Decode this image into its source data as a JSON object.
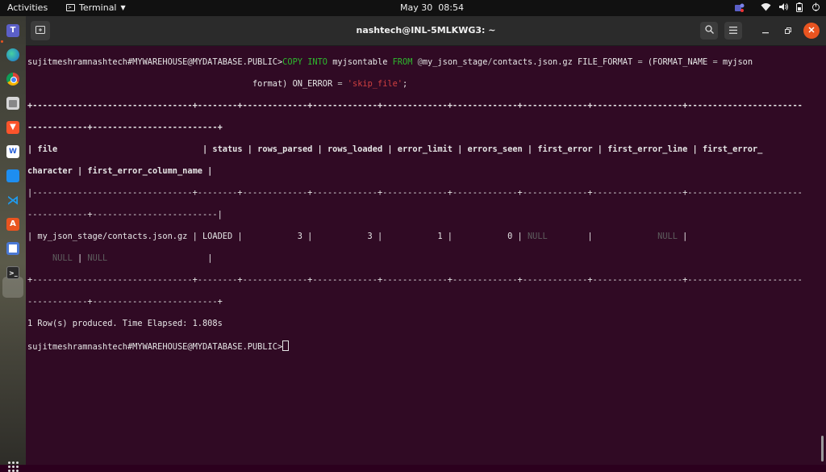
{
  "topbar": {
    "activities": "Activities",
    "app_name": "Terminal",
    "date": "May 30",
    "time": "08:54"
  },
  "dock": {
    "icons": [
      "teams-icon",
      "edge-icon",
      "chrome-icon",
      "files-icon",
      "brave-icon",
      "docs-icon",
      "remote-desktop-icon",
      "vscode-icon",
      "software-center-icon",
      "text-editor-icon",
      "terminal-icon",
      "show-apps-icon"
    ]
  },
  "window": {
    "title": "nashtech@INL-5MLKWG3: ~"
  },
  "terminal": {
    "prompt": "sujitmeshramnashtech#MYWAREHOUSE@MYDATABASE.PUBLIC>",
    "cmd_copy": "COPY",
    "cmd_into": "INTO",
    "cmd_table": "myjsontable",
    "cmd_from": "FROM",
    "cmd_at": "@",
    "cmd_stage": "my_json_stage",
    "cmd_slash": "/",
    "cmd_file": "contacts.json.gz",
    "cmd_file_format": "FILE_FORMAT",
    "cmd_eq1": "=",
    "cmd_format_name": "(FORMAT_NAME",
    "cmd_eq2": "=",
    "cmd_myjson": "myjson",
    "cmd_line2_format": "format)",
    "cmd_on_error": "ON_ERROR",
    "cmd_eq3": "=",
    "cmd_skip_file": "'skip_file'",
    "cmd_semicolon": ";",
    "border_top_1": "+--------------------------------+--------+-------------+-------------+-------------+-------------+-------------+------------------+-----------------------",
    "border_top_2": "------------+-------------------------+",
    "header_1": "| file                             | status | rows_parsed | rows_loaded | error_limit | errors_seen | first_error | first_error_line | first_error_",
    "header_2": "character | first_error_column_name |",
    "border_mid_1": "|--------------------------------+--------+-------------+-------------+-------------+-------------+-------------+------------------+-----------------------",
    "border_mid_2": "------------+-------------------------|",
    "row_pre": "| my_json_stage/contacts.json.gz | LOADED |           3 |           3 |           1 |           0 | ",
    "row_null1": "NULL",
    "row_mid": "        |             ",
    "row_null2": "NULL",
    "row_post": " |",
    "row2_pad": "     ",
    "row2_null3": "NULL",
    "row2_sep": " | ",
    "row2_null4": "NULL",
    "row2_end": "                    |",
    "border_bot_1": "+--------------------------------+--------+-------------+-------------+-------------+-------------+-------------+------------------+-----------------------",
    "border_bot_2": "------------+-------------------------+",
    "result": "1 Row(s) produced. Time Elapsed: 1.808s",
    "prompt2": "sujitmeshramnashtech#MYWAREHOUSE@MYDATABASE.PUBLIC>"
  },
  "colors": {
    "terminal_bg": "#300a24",
    "keyword": "#2dbb2d",
    "string": "#d04040",
    "null": "#5e5e5e",
    "close_button": "#e95420"
  }
}
